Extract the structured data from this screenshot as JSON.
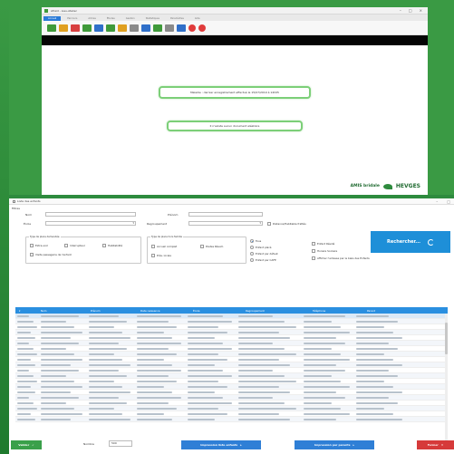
{
  "upper_window": {
    "title": "Afraid - Lieu-Atelier",
    "tabs": [
      "Accueil",
      "Parcours",
      "Arbres",
      "Études",
      "Gestion",
      "Statistiques",
      "Paramètres",
      "Aide"
    ],
    "message_primary": "Maladie : dernier enregistrement effectué le 15/07/2019 à 14h05",
    "message_secondary": "Il n'existe aucun document aléatoire",
    "brand_left": "AMIS bridale",
    "brand_right": "HEVGES"
  },
  "lower_window": {
    "title": "Liste des enfants",
    "filters": {
      "section_label": "Filtres",
      "nom_label": "Nom",
      "prenom_label": "Prénom",
      "ecole_label": "École",
      "regroupement_label": "Regroupement",
      "homonymes_label": "Distance/Habitable frattés",
      "group1_title": "Type de place demandée",
      "group1_options": [
        "Extra-scol",
        "Interrupteur",
        "Habitabilité",
        "Visite passagerie de l'enfant"
      ],
      "group2_title": "Type de place hors famille",
      "group2_options": [
        "Accueil complet",
        "Postes Résum",
        "Prés. locale"
      ],
      "radio_options": [
        "Tous",
        "Enfant placé",
        "Enfant par défaut",
        "Enfant par CAFE"
      ],
      "right_options": [
        "Enfant Résidé",
        "Horaire Scolaire",
        "Afficher l'adresse par le biais des Enfants"
      ],
      "search_button": "Rechercher..."
    },
    "table_columns": [
      "Nom",
      "Prénom",
      "Date naissance",
      "École",
      "Regroupement",
      "Téléphone",
      "Parent"
    ],
    "footer": {
      "validate_label": "Valider",
      "number_label": "Nombre",
      "number_value": "500",
      "print_children_label": "Impression liste enfants",
      "print_parents_label": "Impression par parents",
      "close_label": "Fermer"
    }
  },
  "colors": {
    "desktop_green": "#3a9a44",
    "accent_blue": "#1e8fd8",
    "header_blue": "#2a8fe0",
    "close_red": "#d63a3a"
  }
}
